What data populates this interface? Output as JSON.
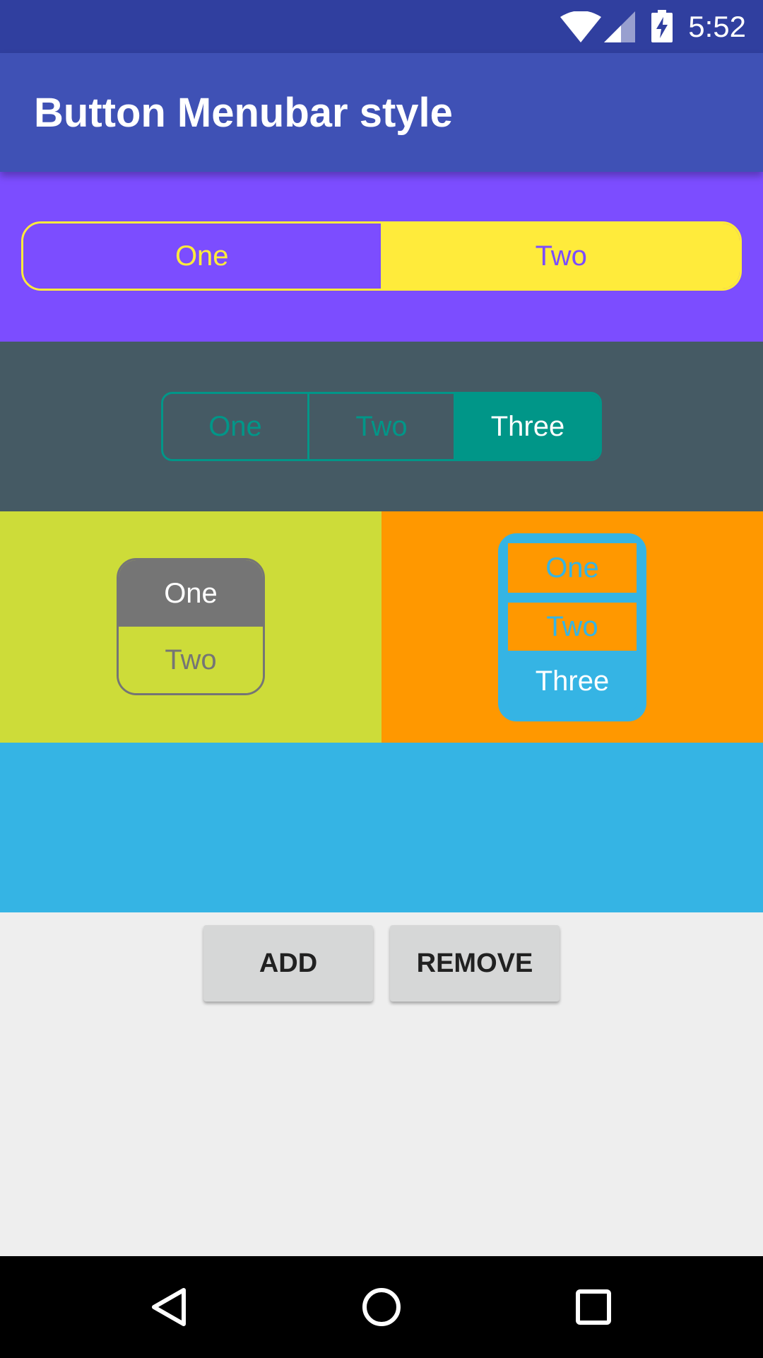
{
  "status_bar": {
    "time": "5:52",
    "icons": [
      "wifi-icon",
      "signal-icon",
      "battery-charging-icon"
    ],
    "color": "#303f9f"
  },
  "app_bar": {
    "title": "Button Menubar style",
    "color": "#3f51b5"
  },
  "menubars": [
    {
      "orientation": "horizontal",
      "background": "#7c4dff",
      "accent": "#ffeb3b",
      "buttons": [
        {
          "label": "One",
          "selected": false
        },
        {
          "label": "Two",
          "selected": true
        }
      ]
    },
    {
      "orientation": "horizontal",
      "background": "#455a64",
      "accent": "#009688",
      "buttons": [
        {
          "label": "One",
          "selected": false
        },
        {
          "label": "Two",
          "selected": false
        },
        {
          "label": "Three",
          "selected": true
        }
      ]
    },
    {
      "orientation": "vertical",
      "background": "#cddc39",
      "accent": "#757575",
      "buttons": [
        {
          "label": "One",
          "selected": true
        },
        {
          "label": "Two",
          "selected": false
        }
      ]
    },
    {
      "orientation": "vertical",
      "background": "#ff9800",
      "accent": "#35b4e4",
      "buttons": [
        {
          "label": "One",
          "selected": false
        },
        {
          "label": "Two",
          "selected": false
        },
        {
          "label": "Three",
          "selected": true
        }
      ]
    }
  ],
  "empty_panel": {
    "background": "#35b4e4"
  },
  "actions": {
    "add_label": "ADD",
    "remove_label": "REMOVE"
  },
  "nav_bar": {
    "icons": [
      "back-icon",
      "home-icon",
      "recents-icon"
    ]
  }
}
